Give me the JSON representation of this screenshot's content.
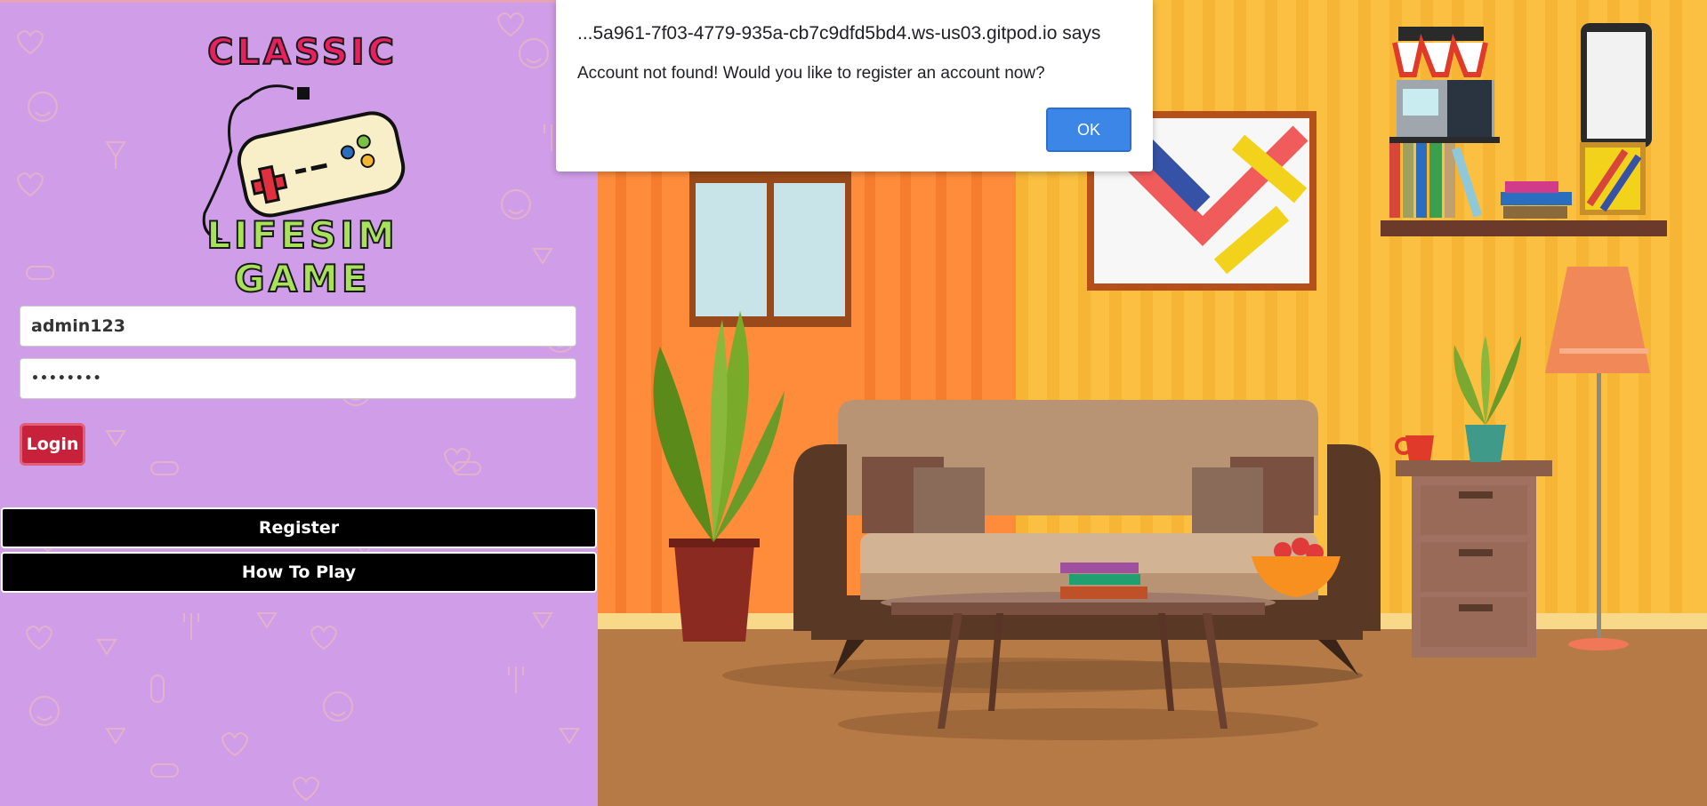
{
  "login": {
    "logo": {
      "line1": "CLASSIC",
      "line2": "LIFESIM GAME"
    },
    "username_value": "admin123",
    "password_value": "••••••••",
    "login_label": "Login",
    "register_label": "Register",
    "howto_label": "How To Play"
  },
  "dialog": {
    "title": "...5a961-7f03-4779-935a-cb7c9dfd5bd4.ws-us03.gitpod.io says",
    "message": "Account not found! Would you like to register an account now?",
    "ok_label": "OK"
  },
  "colors": {
    "panel_bg": "#d09ee8",
    "login_button": "#c8213c",
    "wide_button": "#000000",
    "ok_button": "#3b86e6"
  }
}
